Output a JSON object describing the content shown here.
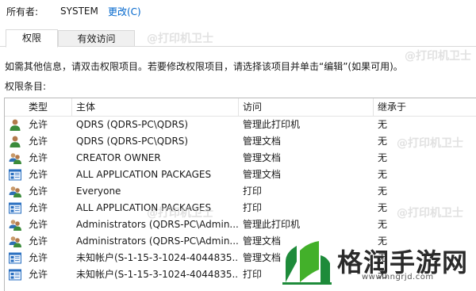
{
  "owner": {
    "label": "所有者:",
    "value": "SYSTEM",
    "change_link": "更改(C)"
  },
  "tabs": [
    {
      "label": "权限"
    },
    {
      "label": "有效访问"
    }
  ],
  "info_text": "如需其他信息，请双击权限项目。若要修改权限项目，请选择该项目并单击“编辑”(如果可用)。",
  "entries_label": "权限条目:",
  "table": {
    "headers": {
      "type": "类型",
      "principal": "主体",
      "access": "访问",
      "inherited": "继承于"
    },
    "rows": [
      {
        "icon": "user-icon",
        "type": "允许",
        "principal": "QDRS (QDRS-PC\\QDRS)",
        "access": "管理此打印机",
        "inherited": "无"
      },
      {
        "icon": "user-icon",
        "type": "允许",
        "principal": "QDRS (QDRS-PC\\QDRS)",
        "access": "管理文档",
        "inherited": "无"
      },
      {
        "icon": "group-icon",
        "type": "允许",
        "principal": "CREATOR OWNER",
        "access": "管理文档",
        "inherited": "无"
      },
      {
        "icon": "app-package-icon",
        "type": "允许",
        "principal": "ALL APPLICATION PACKAGES",
        "access": "管理文档",
        "inherited": "无"
      },
      {
        "icon": "group-icon",
        "type": "允许",
        "principal": "Everyone",
        "access": "打印",
        "inherited": "无"
      },
      {
        "icon": "app-package-icon",
        "type": "允许",
        "principal": "ALL APPLICATION PACKAGES",
        "access": "打印",
        "inherited": "无"
      },
      {
        "icon": "group-icon",
        "type": "允许",
        "principal": "Administrators (QDRS-PC\\Admin...",
        "access": "管理此打印机",
        "inherited": "无"
      },
      {
        "icon": "group-icon",
        "type": "允许",
        "principal": "Administrators (QDRS-PC\\Admin...",
        "access": "管理文档",
        "inherited": "无"
      },
      {
        "icon": "app-package-icon",
        "type": "允许",
        "principal": "未知帐户(S-1-15-3-1024-4044835...",
        "access": "管理文档",
        "inherited": "无"
      },
      {
        "icon": "app-package-icon",
        "type": "允许",
        "principal": "未知帐户(S-1-15-3-1024-4044835...",
        "access": "打印",
        "inherited": "无"
      }
    ]
  },
  "watermark": {
    "text": "@打印机卫士",
    "site_name": "格润手游网",
    "site_url": "www.hngrjd.com"
  }
}
